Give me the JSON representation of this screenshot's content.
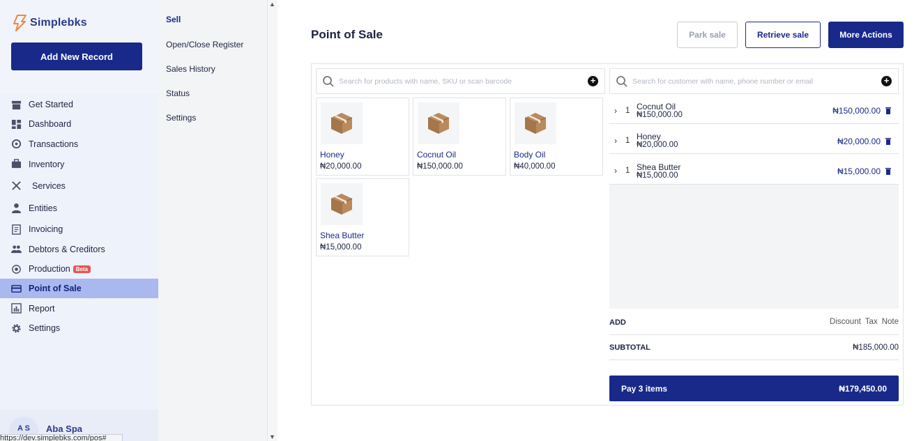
{
  "app": {
    "logo_text": "Simplebks",
    "add_record_label": "Add New Record"
  },
  "sidebar": {
    "items": [
      {
        "label": "Get Started",
        "icon": "store-icon"
      },
      {
        "label": "Dashboard",
        "icon": "dashboard-icon"
      },
      {
        "label": "Transactions",
        "icon": "transactions-icon"
      },
      {
        "label": "Inventory",
        "icon": "briefcase-icon"
      },
      {
        "label": "Services",
        "icon": "tools-icon"
      },
      {
        "label": "Entities",
        "icon": "person-icon"
      },
      {
        "label": "Invoicing",
        "icon": "invoice-icon"
      },
      {
        "label": "Debtors & Creditors",
        "icon": "people-icon"
      },
      {
        "label": "Production",
        "icon": "production-icon",
        "badge": "Beta"
      },
      {
        "label": "Point of Sale",
        "icon": "card-icon",
        "active": true
      },
      {
        "label": "Report",
        "icon": "report-icon"
      },
      {
        "label": "Settings",
        "icon": "gear-icon"
      }
    ],
    "user": {
      "initials": "A S",
      "name": "Aba Spa"
    },
    "status_url": "https://dev.simplebks.com/pos#"
  },
  "subnav": {
    "items": [
      "Sell",
      "Open/Close Register",
      "Sales History",
      "Status",
      "Settings"
    ],
    "active": "Sell"
  },
  "main": {
    "title": "Point of Sale",
    "buttons": {
      "park": "Park sale",
      "retrieve": "Retrieve sale",
      "more": "More Actions"
    },
    "product_search_placeholder": "Search for products with name, SKU or scan barcode",
    "customer_search_placeholder": "Search for customer with name, phone number or email",
    "products": [
      {
        "name": "Honey",
        "price": "₦20,000.00"
      },
      {
        "name": "Cocnut Oil",
        "price": "₦150,000.00"
      },
      {
        "name": "Body Oil",
        "price": "₦40,000.00"
      },
      {
        "name": "Shea Butter",
        "price": "₦15,000.00"
      }
    ],
    "cart": [
      {
        "qty": "1",
        "name": "Cocnut Oil",
        "price": "₦150,000.00",
        "total": "₦150,000.00"
      },
      {
        "qty": "1",
        "name": "Honey",
        "price": "₦20,000.00",
        "total": "₦20,000.00"
      },
      {
        "qty": "1",
        "name": "Shea Butter",
        "price": "₦15,000.00",
        "total": "₦15,000.00"
      }
    ],
    "add_label": "ADD",
    "add_links": {
      "discount": "Discount",
      "tax": "Tax",
      "note": "Note"
    },
    "subtotal_label": "SUBTOTAL",
    "subtotal_value": "₦185,000.00",
    "pay_label": "Pay 3 items",
    "pay_total": "₦179,450.00"
  },
  "colors": {
    "primary": "#19298a",
    "active_nav": "#aab8f0",
    "beta": "#e25757"
  }
}
